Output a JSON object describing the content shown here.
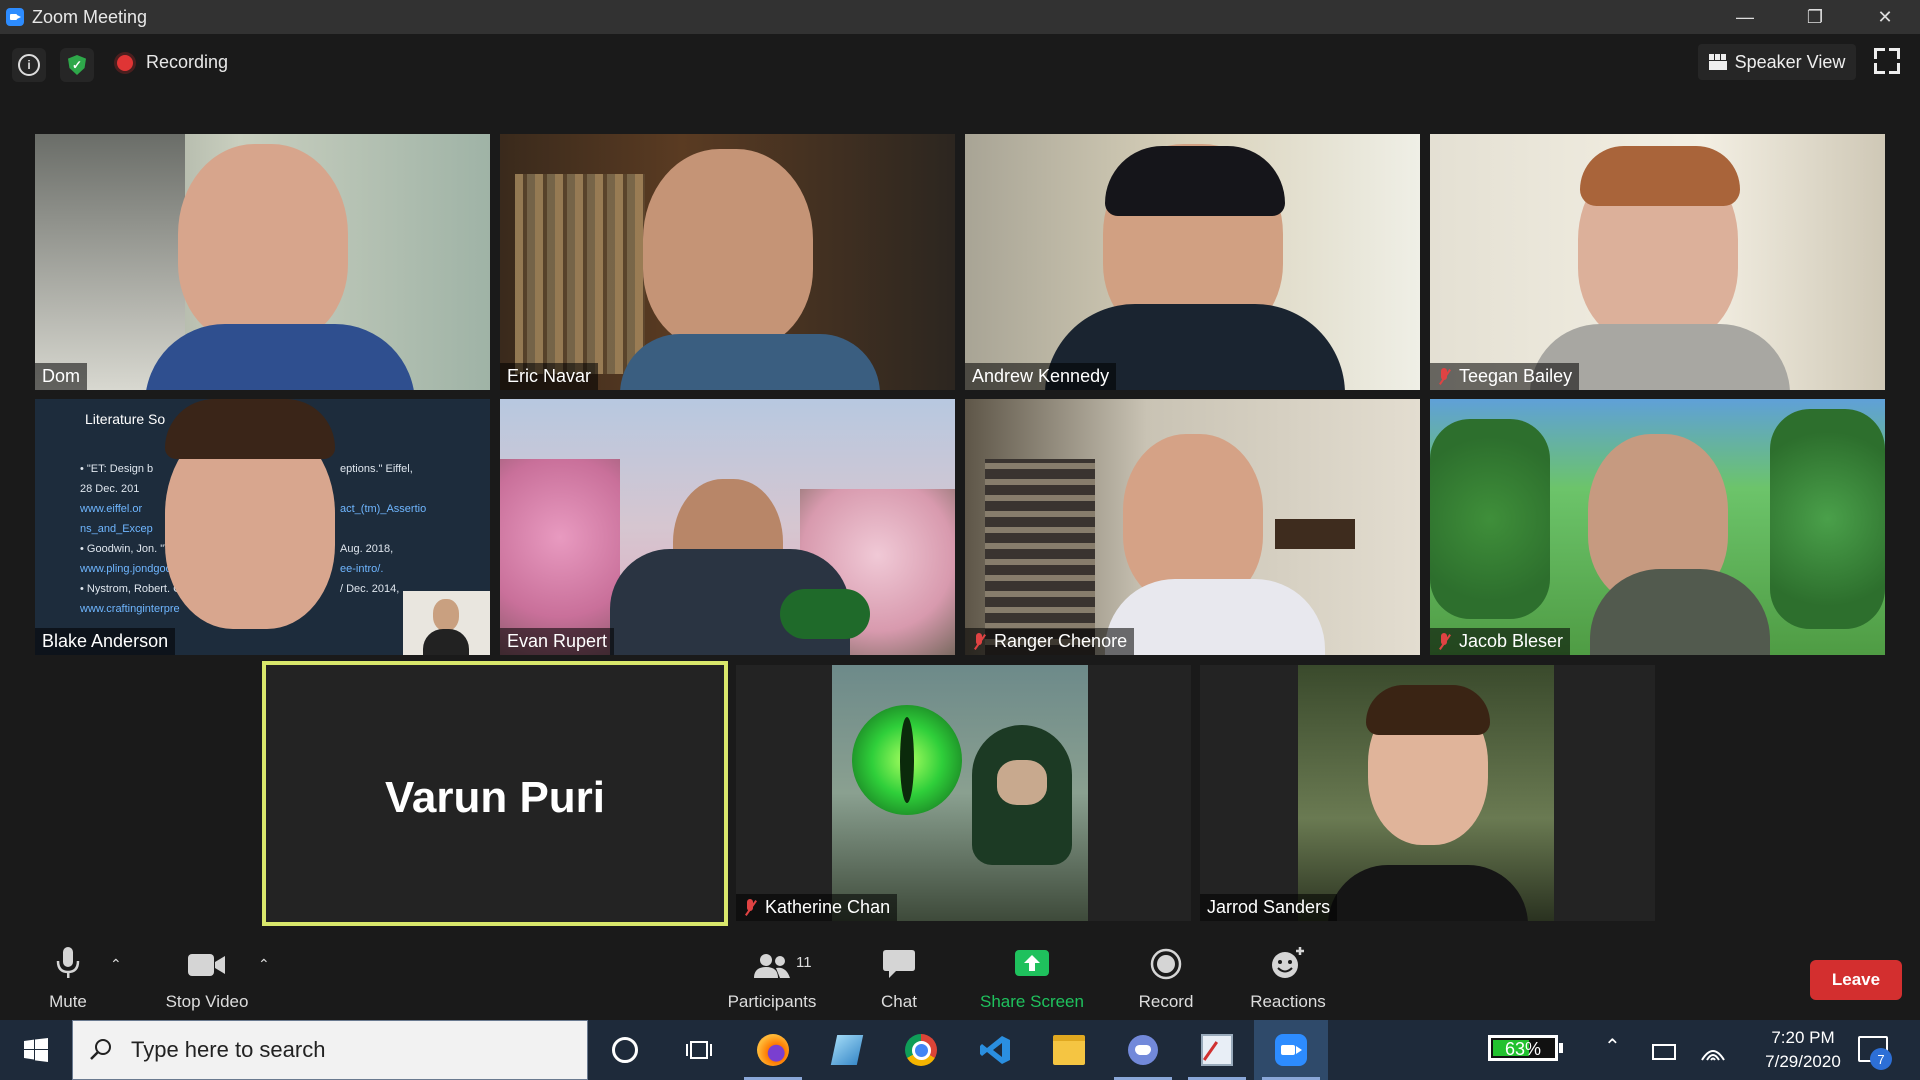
{
  "window": {
    "title": "Zoom Meeting"
  },
  "top_bar": {
    "recording_label": "Recording",
    "view_label": "Speaker View"
  },
  "participants": {
    "dom": "Dom",
    "eric": "Eric Navar",
    "andrew": "Andrew Kennedy",
    "teegan": "Teegan Bailey",
    "blake": "Blake Anderson",
    "evan": "Evan Rupert",
    "ranger": "Ranger Chenore",
    "jacob": "Jacob Bleser",
    "varun": "Varun Puri",
    "katherine": "Katherine Chan",
    "jarrod": "Jarrod Sanders"
  },
  "slide_text": {
    "heading": "Literature So",
    "b1": "• \"ET: Design b",
    "b1b": "eptions.\" Eiffel,",
    "b2": "28 Dec. 201",
    "b3": "www.eiffel.or",
    "b3b": "act_(tm)_Assertio",
    "b4": "ns_and_Excep",
    "b5": "• Goodwin, Jon. \"Ti",
    "b5b": "Aug. 2018,",
    "b6": "www.pling.jondgood",
    "b6b": "ee-intro/.",
    "b7": "• Nystrom, Robert. Cro",
    "b7b": "/ Dec. 2014,",
    "b8": "www.craftinginterpre"
  },
  "toolbar": {
    "mute": "Mute",
    "stop_video": "Stop Video",
    "participants": "Participants",
    "participant_count": "11",
    "chat": "Chat",
    "share_screen": "Share Screen",
    "record": "Record",
    "reactions": "Reactions",
    "leave": "Leave"
  },
  "taskbar": {
    "search_placeholder": "Type here to search",
    "battery": "63%",
    "battery_level": 0.63,
    "time": "7:20 PM",
    "date": "7/29/2020",
    "notifications": "7"
  },
  "colors": {
    "accent_green": "#2ea84a",
    "leave_red": "#d32f2f",
    "active_speaker_border": "#d9e76b",
    "share_green": "#1fc15d"
  }
}
